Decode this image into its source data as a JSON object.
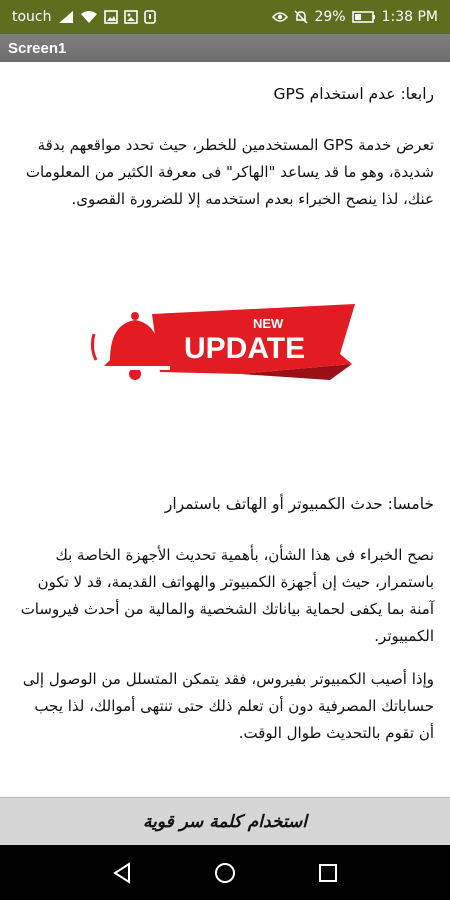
{
  "status_bar": {
    "carrier": "touch",
    "signal_label": "4G",
    "battery_percent": "29%",
    "time": "1:38 PM",
    "icons": [
      "signal-icon",
      "wifi-icon",
      "photo-icon",
      "image-icon",
      "notification-icon",
      "eye-icon",
      "mute-icon",
      "battery-icon"
    ]
  },
  "app": {
    "title": "Screen1"
  },
  "article": {
    "section4_title": "رابعا: عدم استخدام GPS",
    "section4_body": "تعرض خدمة GPS المستخدمين للخطر، حيث تحدد مواقعهم بدقة شديدة، وهو ما قد يساعد \"الهاكر\" فى معرفة الكثير من المعلومات عنك، لذا ينصح الخبراء بعدم استخدمه إلا للضرورة القصوى.",
    "banner": {
      "line1": "NEW",
      "line2": "UPDATE",
      "icon": "alarm-bell-icon",
      "color_red": "#e31b23",
      "color_dark_red": "#9a1016"
    },
    "section5_title": "خامسا: حدث الكمبيوتر أو الهاتف  باستمرار",
    "section5_body1": "نصح الخبراء فى هذا الشأن، بأهمية تحديث الأجهزة الخاصة بك باستمرار، حيث إن أجهزة الكمبيوتر والهواتف القديمة، قد لا تكون آمنة بما يكفى لحماية بياناتك الشخصية والمالية من أحدث فيروسات الكمبيوتر.",
    "section5_body2": "وإذا أصيب الكمبيوتر بفيروس، فقد يتمكن المتسلل من الوصول إلى حساباتك المصرفية دون أن تعلم ذلك حتى تنتهى أموالك، لذا يجب أن تقوم بالتحديث طوال الوقت."
  },
  "bottom_button": {
    "label": "استخدام كلمة سر قوية"
  },
  "nav": {
    "back": "back-icon",
    "home": "home-icon",
    "recents": "recents-icon"
  },
  "colors": {
    "status_bar": "#5e6e1f",
    "title_bar": "#777777",
    "button_bg": "#d6d6d6"
  }
}
